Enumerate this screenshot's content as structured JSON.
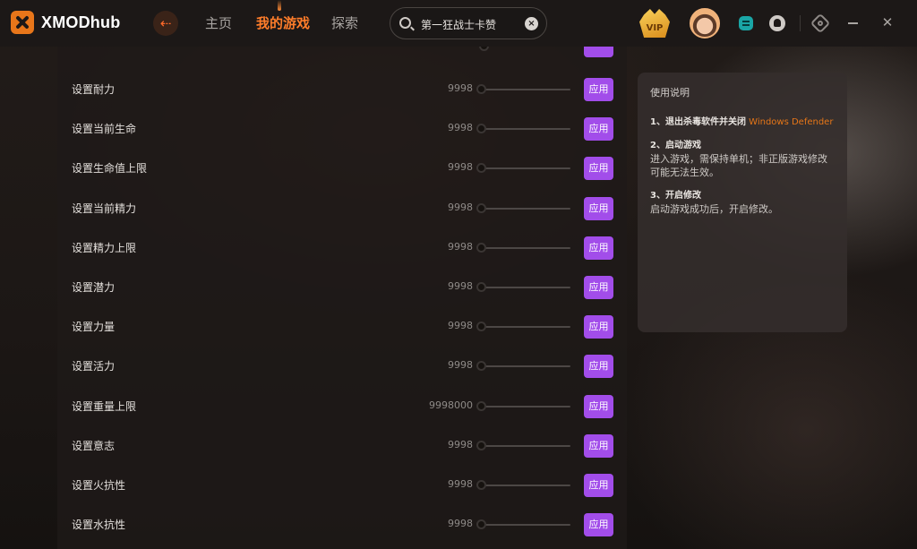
{
  "app": {
    "name": "XMODhub"
  },
  "nav": {
    "home": "主页",
    "my_games": "我的游戏",
    "explore": "探索"
  },
  "search": {
    "value": "第一狂战士卡赞"
  },
  "header": {
    "vip_label": "VIP",
    "close_glyph": "✕",
    "clear_glyph": "×",
    "back_glyph": "⇠"
  },
  "cheats": [
    {
      "label": "设置耐力",
      "value": "9998",
      "level": 0,
      "button": "应用"
    },
    {
      "label": "设置当前生命",
      "value": "9998",
      "level": 0,
      "button": "应用"
    },
    {
      "label": "设置生命值上限",
      "value": "9998",
      "level": 0,
      "button": "应用"
    },
    {
      "label": "设置当前精力",
      "value": "9998",
      "level": 0,
      "button": "应用"
    },
    {
      "label": "设置精力上限",
      "value": "9998",
      "level": 0,
      "button": "应用"
    },
    {
      "label": "设置潜力",
      "value": "9998",
      "level": 0,
      "button": "应用"
    },
    {
      "label": "设置力量",
      "value": "9998",
      "level": 0,
      "button": "应用"
    },
    {
      "label": "设置活力",
      "value": "9998",
      "level": 0,
      "button": "应用"
    },
    {
      "label": "设置重量上限",
      "value": "9998000",
      "level": 0,
      "button": "应用"
    },
    {
      "label": "设置意志",
      "value": "9998",
      "level": 0,
      "button": "应用"
    },
    {
      "label": "设置火抗性",
      "value": "9998",
      "level": 0,
      "button": "应用"
    },
    {
      "label": "设置水抗性",
      "value": "9998",
      "level": 0,
      "button": "应用"
    }
  ],
  "instructions": {
    "title": "使用说明",
    "step1_head": "1、退出杀毒软件并关闭",
    "step1_highlight": "Windows Defender",
    "step2_head": "2、启动游戏",
    "step2_body": "进入游戏，需保持单机；非正版游戏修改可能无法生效。",
    "step3_head": "3、开启修改",
    "step3_body": "启动游戏成功后，开启修改。"
  },
  "colors": {
    "accent_orange": "#ff7d2a",
    "apply_purple": "#a24dea"
  }
}
